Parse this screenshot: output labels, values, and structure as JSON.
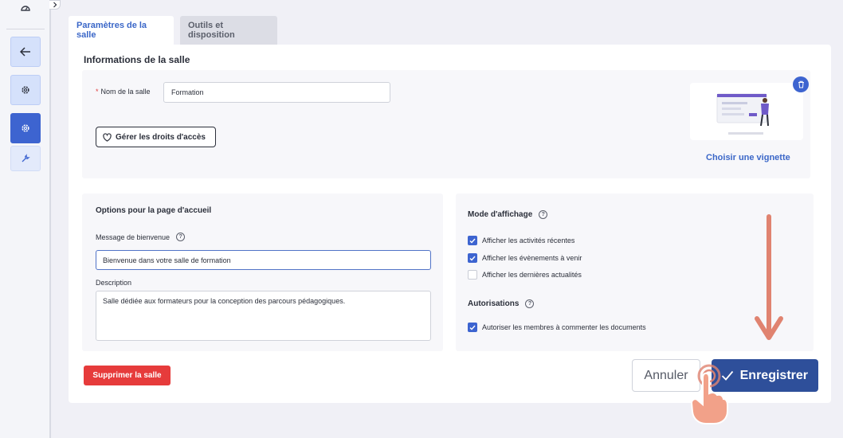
{
  "tabs": [
    {
      "label": "Paramètres de la salle",
      "active": true
    },
    {
      "label": "Outils et disposition",
      "active": false
    }
  ],
  "info": {
    "title": "Informations de la salle",
    "name_label": "Nom de la salle",
    "name_required_mark": "*",
    "name_value": "Formation",
    "rights_button": "Gérer les droits d'accès",
    "thumbnail_link": "Choisir une vignette"
  },
  "options": {
    "title": "Options pour la page d'accueil",
    "welcome_label": "Message de bienvenue",
    "welcome_value": "Bienvenue dans votre salle de formation",
    "description_label": "Description",
    "description_value": "Salle dédiée aux formateurs pour la conception des parcours pédagogiques."
  },
  "display_mode": {
    "title": "Mode d'affichage",
    "items": [
      {
        "label": "Afficher les activités récentes",
        "checked": true
      },
      {
        "label": "Afficher les évènements à venir",
        "checked": true
      },
      {
        "label": "Afficher les dernières actualités",
        "checked": false
      }
    ]
  },
  "permissions": {
    "title": "Autorisations",
    "items": [
      {
        "label": "Autoriser les membres à commenter les documents",
        "checked": true
      }
    ]
  },
  "actions": {
    "delete": "Supprimer la salle",
    "cancel": "Annuler",
    "save": "Enregistrer"
  },
  "help_glyph": "?",
  "colors": {
    "accent": "#3d64d0",
    "save": "#2e4f9a",
    "danger": "#e63b3b",
    "annotation": "#e08370"
  }
}
